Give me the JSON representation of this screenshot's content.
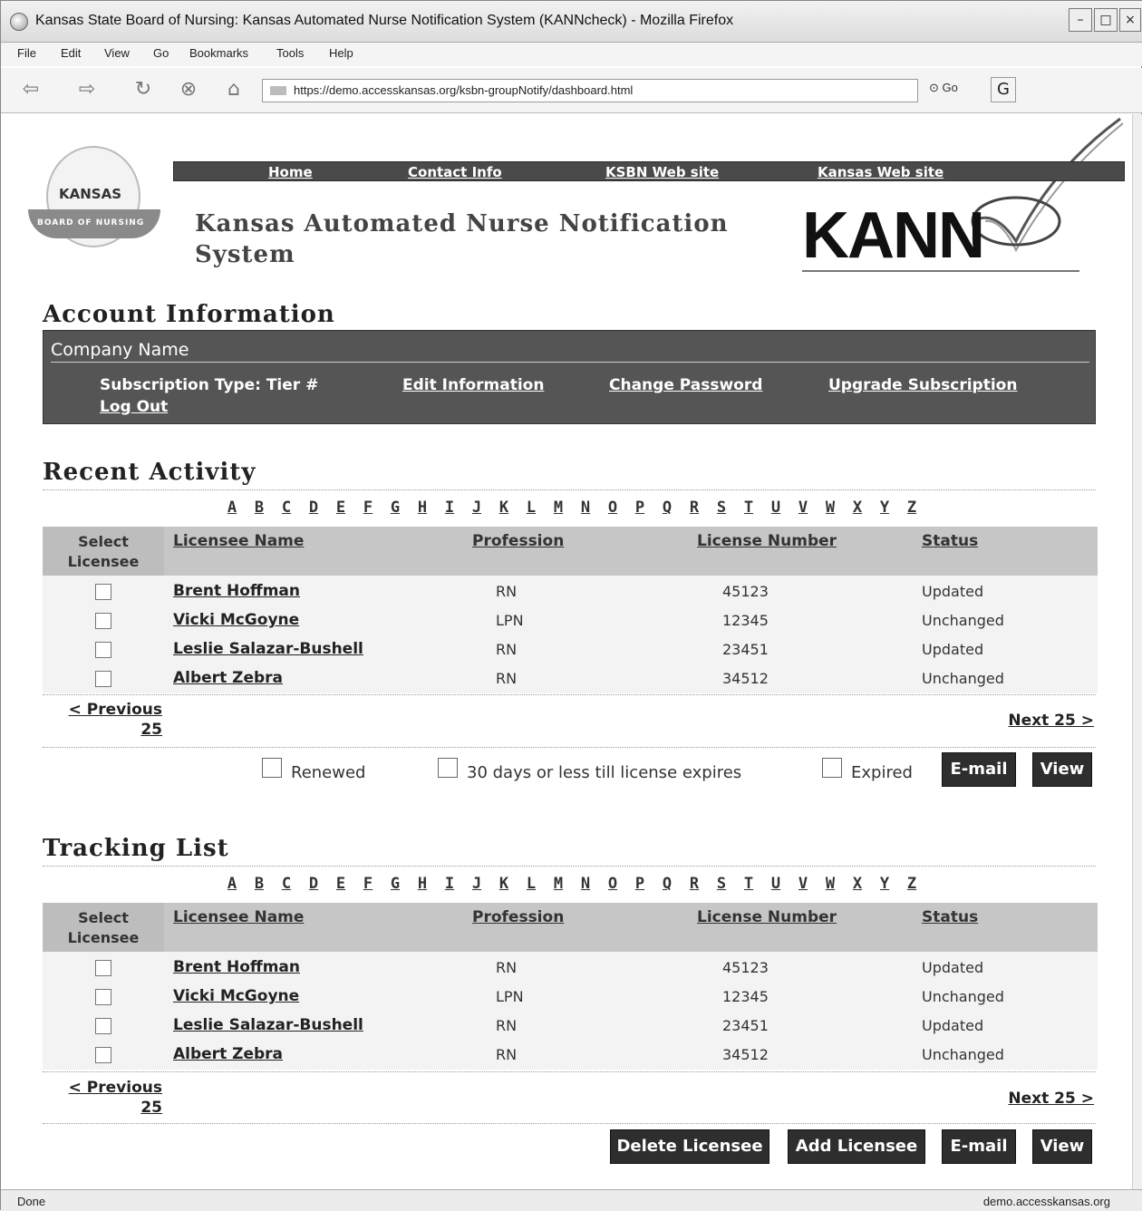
{
  "browser": {
    "window_title": "Kansas State Board of Nursing: Kansas Automated Nurse Notification System (KANNcheck) - Mozilla Firefox",
    "menu": [
      "File",
      "Edit",
      "View",
      "Go",
      "Bookmarks",
      "Tools",
      "Help"
    ],
    "url": "https://demo.accesskansas.org/ksbn-groupNotify/dashboard.html",
    "go_label": "Go",
    "status_left": "Done",
    "status_right": "demo.accesskansas.org"
  },
  "header": {
    "seal_text": "KANSAS",
    "seal_ribbon": "BOARD OF NURSING",
    "nav": [
      "Home",
      "Contact Info",
      "KSBN Web site",
      "Kansas Web site"
    ],
    "title": "Kansas Automated Nurse Notification System",
    "logo_text": "KANN"
  },
  "account": {
    "heading": "Account Information",
    "company_name": "Company Name",
    "subscription": "Subscription Type: Tier #",
    "edit": "Edit Information",
    "change_password": "Change Password",
    "upgrade": "Upgrade Subscription",
    "logout": "Log Out"
  },
  "alphabet": [
    "A",
    "B",
    "C",
    "D",
    "E",
    "F",
    "G",
    "H",
    "I",
    "J",
    "K",
    "L",
    "M",
    "N",
    "O",
    "P",
    "Q",
    "R",
    "S",
    "T",
    "U",
    "V",
    "W",
    "X",
    "Y",
    "Z"
  ],
  "table_headers": {
    "select": "Select Licensee",
    "name": "Licensee Name",
    "profession": "Profession",
    "license": "License Number",
    "status": "Status"
  },
  "recent": {
    "heading": "Recent Activity",
    "rows": [
      {
        "name": "Brent Hoffman",
        "profession": "RN",
        "license": "45123",
        "status": "Updated"
      },
      {
        "name": "Vicki McGoyne",
        "profession": "LPN",
        "license": "12345",
        "status": "Unchanged"
      },
      {
        "name": "Leslie Salazar-Bushell",
        "profession": "RN",
        "license": "23451",
        "status": "Updated"
      },
      {
        "name": "Albert Zebra",
        "profession": "RN",
        "license": "34512",
        "status": "Unchanged"
      }
    ],
    "prev": "< Previous 25",
    "next": "Next 25 >",
    "filter_renewed": "Renewed",
    "filter_30days": "30 days or less till license expires",
    "filter_expired": "Expired",
    "email": "E-mail",
    "view": "View"
  },
  "tracking": {
    "heading": "Tracking List",
    "rows": [
      {
        "name": "Brent Hoffman",
        "profession": "RN",
        "license": "45123",
        "status": "Updated"
      },
      {
        "name": "Vicki McGoyne",
        "profession": "LPN",
        "license": "12345",
        "status": "Unchanged"
      },
      {
        "name": "Leslie Salazar-Bushell",
        "profession": "RN",
        "license": "23451",
        "status": "Updated"
      },
      {
        "name": "Albert Zebra",
        "profession": "RN",
        "license": "34512",
        "status": "Unchanged"
      }
    ],
    "prev": "< Previous 25",
    "next": "Next 25 >",
    "delete": "Delete Licensee",
    "add": "Add Licensee",
    "email": "E-mail",
    "view": "View"
  }
}
